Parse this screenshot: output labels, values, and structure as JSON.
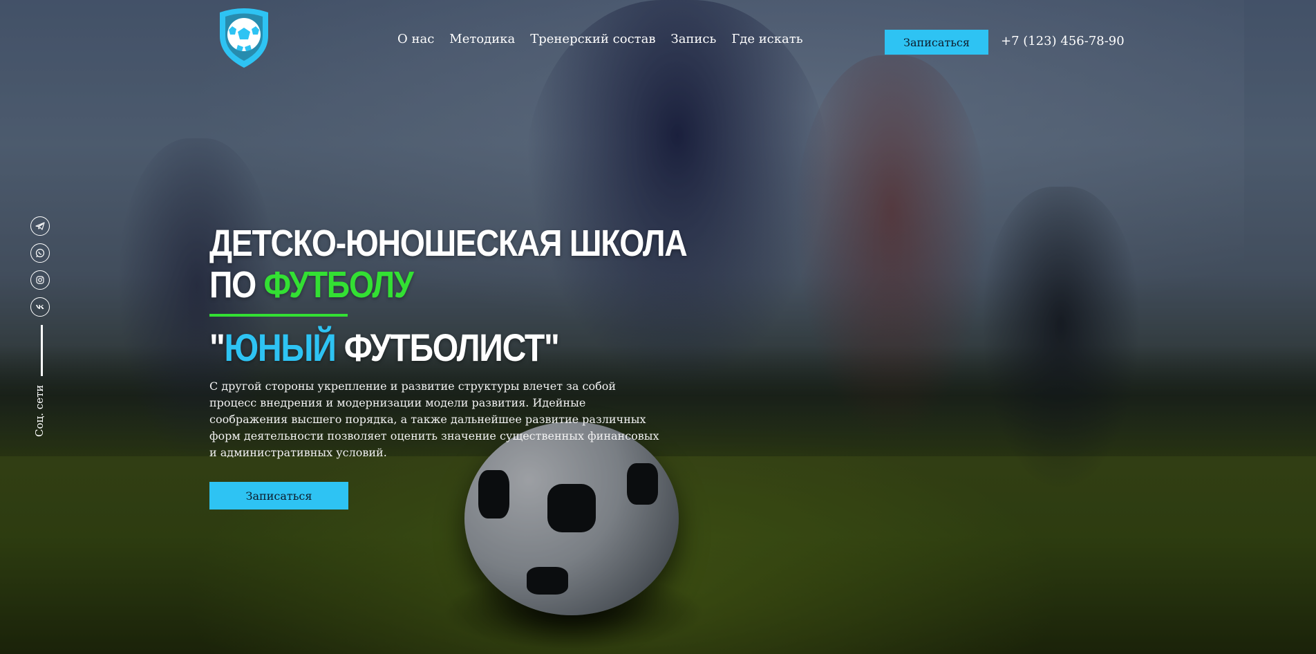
{
  "colors": {
    "accent_blue": "#2ec3f3",
    "accent_green": "#33e033",
    "text": "#ffffff"
  },
  "header": {
    "logo_icon": "soccer-ball-shield-icon",
    "nav": [
      {
        "label": "О нас"
      },
      {
        "label": "Методика"
      },
      {
        "label": "Тренерский состав"
      },
      {
        "label": "Запись"
      },
      {
        "label": "Где искать"
      }
    ],
    "cta_label": "Записаться",
    "phone": "+7 (123) 456-78-90"
  },
  "social": {
    "icons": [
      "telegram-icon",
      "whatsapp-icon",
      "instagram-icon",
      "vk-icon"
    ],
    "label": "Соц. сети"
  },
  "hero": {
    "title_line1": "ДЕТСКО-ЮНОШЕСКАЯ ШКОЛА",
    "title_line2_prefix": "ПО ",
    "title_line2_accent": "ФУТБОЛУ",
    "subtitle_open_quote": "\"",
    "subtitle_accent": "ЮНЫЙ",
    "subtitle_rest": " ФУТБОЛИСТ\"",
    "description": "С другой стороны укрепление и развитие структуры влечет за собой процесс внедрения и модернизации модели развития. Идейные соображения высшего порядка, а также дальнейшее развитие различных форм деятельности позволяет оценить значение существенных финансовых и административных условий.",
    "cta_label": "Записаться"
  }
}
